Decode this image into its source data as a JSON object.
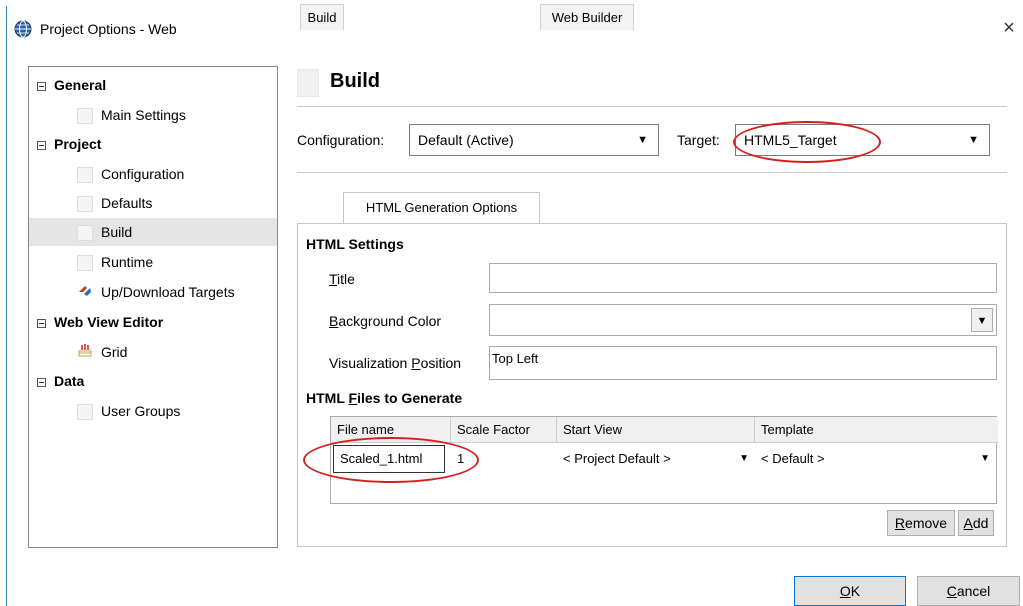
{
  "window": {
    "title": "Project Options - Web",
    "close_glyph": "×"
  },
  "tree": [
    {
      "label": "General",
      "kind": "group",
      "expander": true
    },
    {
      "label": "Main Settings",
      "kind": "child",
      "icon": "blank-page-icon"
    },
    {
      "label": "Project",
      "kind": "group",
      "expander": true
    },
    {
      "label": "Configuration",
      "kind": "child",
      "icon": "blank-page-icon"
    },
    {
      "label": "Defaults",
      "kind": "child",
      "icon": "blank-page-icon"
    },
    {
      "label": "Build",
      "kind": "child",
      "icon": "blank-page-icon",
      "selected": true
    },
    {
      "label": "Runtime",
      "kind": "child",
      "icon": "blank-page-icon"
    },
    {
      "label": "Up/Download Targets",
      "kind": "child",
      "icon": "transfer-icon"
    },
    {
      "label": "Web View Editor",
      "kind": "group",
      "expander": true
    },
    {
      "label": "Grid",
      "kind": "child",
      "icon": "grid-icon"
    },
    {
      "label": "Data",
      "kind": "group",
      "expander": true
    },
    {
      "label": "User Groups",
      "kind": "child",
      "icon": "blank-page-icon"
    }
  ],
  "page": {
    "heading": "Build"
  },
  "config": {
    "configuration_label": "Configuration:",
    "configuration_value": "Default (Active)",
    "target_label": "Target:",
    "target_value": "HTML5_Target"
  },
  "tabs": [
    "Build",
    "HTML Generation Options",
    "Web Builder"
  ],
  "html_settings": {
    "section_title": "HTML Settings",
    "title_label": "Title",
    "title_value": "",
    "bg_label": "Background Color",
    "bg_value": "",
    "vis_label": "Visualization Position",
    "vis_value": "Top Left"
  },
  "files": {
    "section_title": "HTML Files to Generate",
    "columns": [
      "File name",
      "Scale Factor",
      "Start View",
      "Template"
    ],
    "rows": [
      {
        "file_name": "Scaled_1.html",
        "scale_factor": "1",
        "start_view": "< Project Default >",
        "template": "< Default >"
      }
    ],
    "remove_label": "Remove",
    "add_label": "Add"
  },
  "footer": {
    "ok_label": "OK",
    "cancel_label": "Cancel"
  },
  "colors": {
    "annotation": "#d62020",
    "selection": "#e5e5e5",
    "accent": "#0078d7"
  }
}
